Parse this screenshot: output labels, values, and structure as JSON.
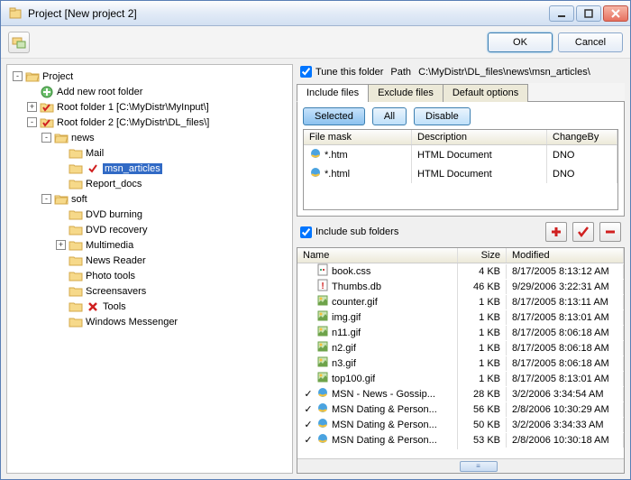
{
  "window": {
    "title": "Project [New project 2]"
  },
  "buttons": {
    "ok": "OK",
    "cancel": "Cancel"
  },
  "tree": [
    {
      "label": "Project",
      "icon": "folder-open",
      "exp": "-",
      "children": [
        {
          "label": "Add new root folder",
          "icon": "add",
          "exp": ""
        },
        {
          "label": "Root folder 1 [C:\\MyDistr\\MyInput\\]",
          "icon": "folder-check",
          "exp": "+"
        },
        {
          "label": "Root folder 2 [C:\\MyDistr\\DL_files\\]",
          "icon": "folder-check",
          "exp": "-",
          "children": [
            {
              "label": "news",
              "icon": "folder-open",
              "exp": "-",
              "children": [
                {
                  "label": "Mail",
                  "icon": "folder",
                  "exp": ""
                },
                {
                  "label": "msn_articles",
                  "icon": "folder",
                  "exp": "",
                  "sel": true,
                  "mark": true
                },
                {
                  "label": "Report_docs",
                  "icon": "folder",
                  "exp": ""
                }
              ]
            },
            {
              "label": "soft",
              "icon": "folder-open",
              "exp": "-",
              "children": [
                {
                  "label": "DVD burning",
                  "icon": "folder",
                  "exp": ""
                },
                {
                  "label": "DVD recovery",
                  "icon": "folder",
                  "exp": ""
                },
                {
                  "label": "Multimedia",
                  "icon": "folder",
                  "exp": "+"
                },
                {
                  "label": "News Reader",
                  "icon": "folder",
                  "exp": ""
                },
                {
                  "label": "Photo tools",
                  "icon": "folder",
                  "exp": ""
                },
                {
                  "label": "Screensavers",
                  "icon": "folder",
                  "exp": ""
                },
                {
                  "label": "Tools",
                  "icon": "folder",
                  "exp": "",
                  "x": true
                },
                {
                  "label": "Windows Messenger",
                  "icon": "folder",
                  "exp": ""
                }
              ]
            }
          ]
        }
      ]
    }
  ],
  "tune": {
    "label": "Tune this folder",
    "checked": true
  },
  "path": {
    "label": "Path",
    "value": "C:\\MyDistr\\DL_files\\news\\msn_articles\\"
  },
  "tabs": {
    "t1": "Include files",
    "t2": "Exclude files",
    "t3": "Default options"
  },
  "segbtns": {
    "selected": "Selected",
    "all": "All",
    "disable": "Disable"
  },
  "maskhead": {
    "c1": "File mask",
    "c2": "Description",
    "c3": "ChangeBy"
  },
  "masks": [
    {
      "mask": "*.htm",
      "desc": "HTML Document",
      "by": "DNO"
    },
    {
      "mask": "*.html",
      "desc": "HTML Document",
      "by": "DNO"
    }
  ],
  "includesub": {
    "label": "Include sub folders",
    "checked": true
  },
  "filehead": {
    "c1": "Name",
    "c2": "Size",
    "c3": "Modified"
  },
  "files": [
    {
      "check": false,
      "icon": "css",
      "name": "book.css",
      "size": "4 KB",
      "mod": "8/17/2005 8:13:12 AM"
    },
    {
      "check": false,
      "icon": "warn",
      "name": "Thumbs.db",
      "size": "46 KB",
      "mod": "9/29/2006 3:22:31 AM"
    },
    {
      "check": false,
      "icon": "gif",
      "name": "counter.gif",
      "size": "1 KB",
      "mod": "8/17/2005 8:13:11 AM"
    },
    {
      "check": false,
      "icon": "gif",
      "name": "img.gif",
      "size": "1 KB",
      "mod": "8/17/2005 8:13:01 AM"
    },
    {
      "check": false,
      "icon": "gif",
      "name": "n11.gif",
      "size": "1 KB",
      "mod": "8/17/2005 8:06:18 AM"
    },
    {
      "check": false,
      "icon": "gif",
      "name": "n2.gif",
      "size": "1 KB",
      "mod": "8/17/2005 8:06:18 AM"
    },
    {
      "check": false,
      "icon": "gif",
      "name": "n3.gif",
      "size": "1 KB",
      "mod": "8/17/2005 8:06:18 AM"
    },
    {
      "check": false,
      "icon": "gif",
      "name": "top100.gif",
      "size": "1 KB",
      "mod": "8/17/2005 8:13:01 AM"
    },
    {
      "check": true,
      "icon": "ie",
      "name": "MSN - News - Gossip...",
      "size": "28 KB",
      "mod": "3/2/2006 3:34:54 AM"
    },
    {
      "check": true,
      "icon": "ie",
      "name": "MSN Dating & Person...",
      "size": "56 KB",
      "mod": "2/8/2006 10:30:29 AM"
    },
    {
      "check": true,
      "icon": "ie",
      "name": "MSN Dating & Person...",
      "size": "50 KB",
      "mod": "3/2/2006 3:34:33 AM"
    },
    {
      "check": true,
      "icon": "ie",
      "name": "MSN Dating & Person...",
      "size": "53 KB",
      "mod": "2/8/2006 10:30:18 AM"
    }
  ]
}
